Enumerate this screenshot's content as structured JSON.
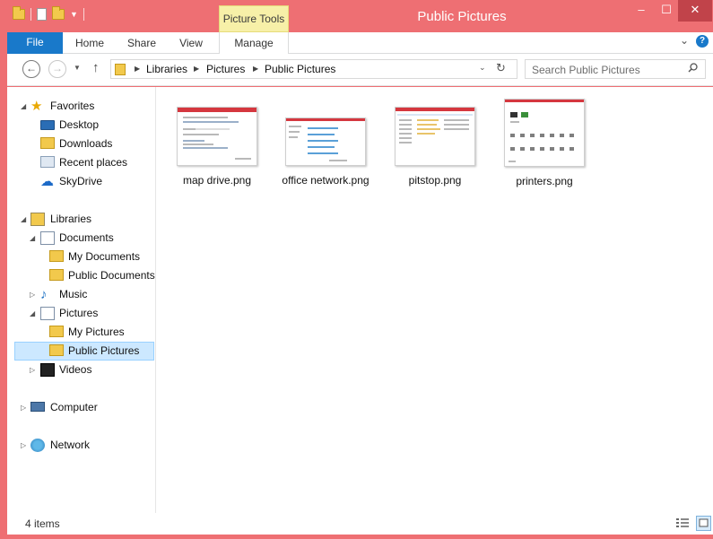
{
  "window": {
    "title": "Public Pictures",
    "contextual_tab": "Picture Tools",
    "controls": {
      "minimize": "–",
      "maximize": "☐",
      "close": "✕"
    }
  },
  "ribbon": {
    "tabs": [
      {
        "label": "File"
      },
      {
        "label": "Home"
      },
      {
        "label": "Share"
      },
      {
        "label": "View"
      },
      {
        "label": "Manage"
      }
    ],
    "help": "?"
  },
  "address": {
    "crumbs": [
      "Libraries",
      "Pictures",
      "Public Pictures"
    ],
    "search_placeholder": "Search Public Pictures"
  },
  "nav": {
    "favorites": {
      "label": "Favorites",
      "items": [
        "Desktop",
        "Downloads",
        "Recent places",
        "SkyDrive"
      ]
    },
    "libraries": {
      "label": "Libraries",
      "documents": {
        "label": "Documents",
        "children": [
          "My Documents",
          "Public Documents"
        ]
      },
      "music": "Music",
      "pictures": {
        "label": "Pictures",
        "children": [
          "My Pictures",
          "Public Pictures"
        ]
      },
      "videos": "Videos"
    },
    "computer": "Computer",
    "network": "Network",
    "selected": "Public Pictures"
  },
  "files": [
    {
      "name": "map drive.png"
    },
    {
      "name": "office network.png"
    },
    {
      "name": "pitstop.png"
    },
    {
      "name": "printers.png"
    }
  ],
  "status": {
    "item_count": "4 items"
  },
  "colors": {
    "title_bar": "#ee6f73",
    "file_tab": "#1979ca",
    "contextual_tab": "#f7f0a8",
    "selection": "#cce8ff"
  }
}
